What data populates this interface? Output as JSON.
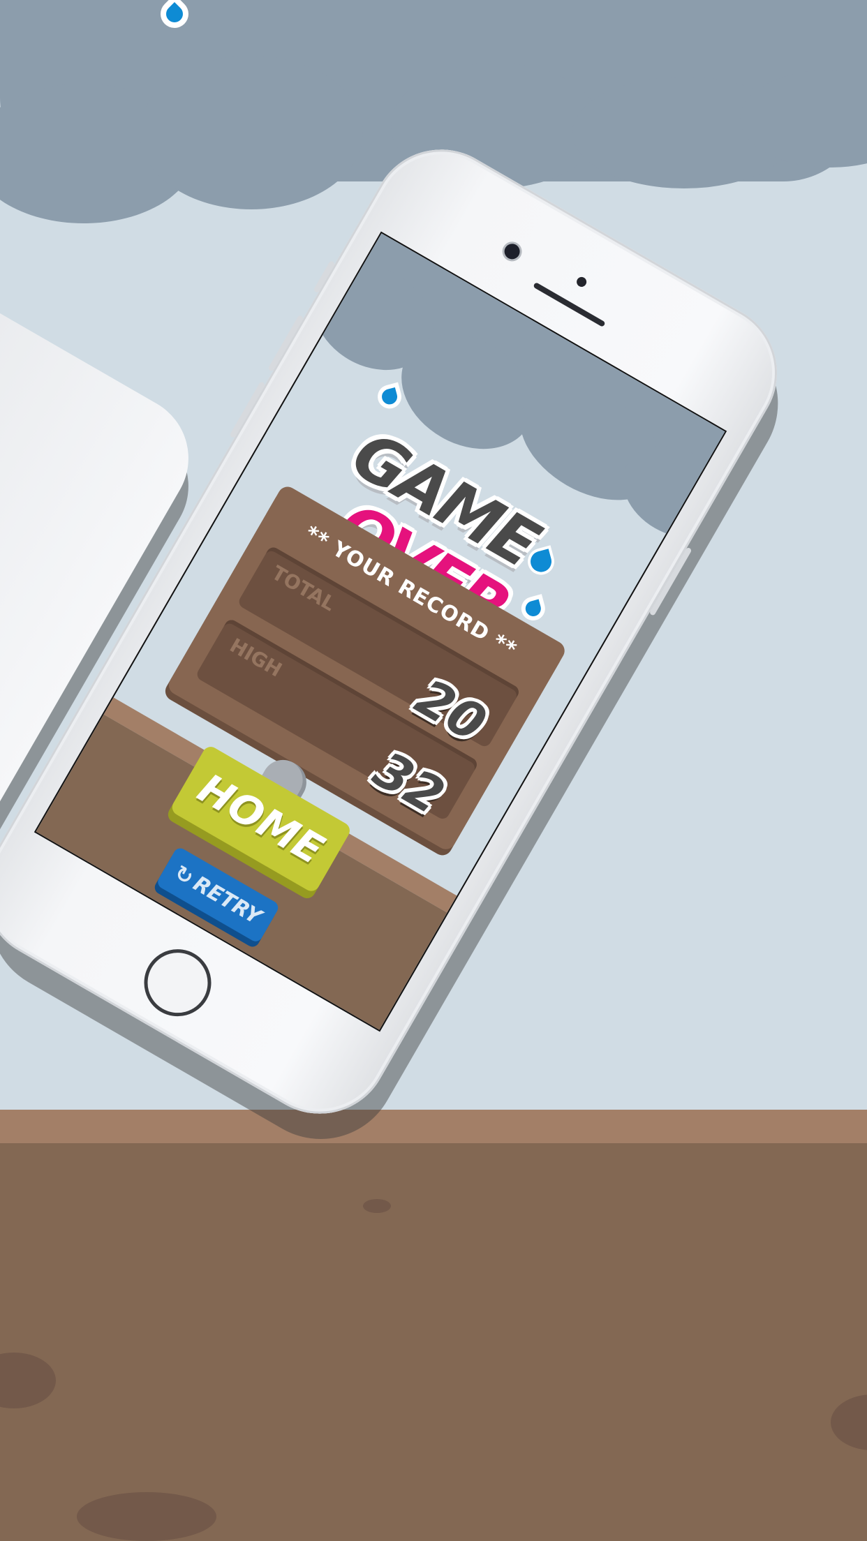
{
  "title": {
    "game": "GAME",
    "over": "OVER"
  },
  "record": {
    "header": "** YOUR RECORD **",
    "rows": [
      {
        "label": "TOTAL",
        "value": "20"
      },
      {
        "label": "HIGH",
        "value": "32"
      }
    ]
  },
  "buttons": {
    "home": "HOME",
    "retry": "RETRY",
    "retry_icon": "↻"
  },
  "colors": {
    "sky": "#d0dce4",
    "cloud": "#8c9dac",
    "ground": "#836853",
    "board": "#876651",
    "home_button": "#c3c935",
    "retry_button": "#1c73c4",
    "title_game": "#4a4a4a",
    "title_over": "#e5127d",
    "raindrop": "#0e8bd4"
  },
  "icons": [
    "raindrop-icon",
    "retry-icon"
  ]
}
